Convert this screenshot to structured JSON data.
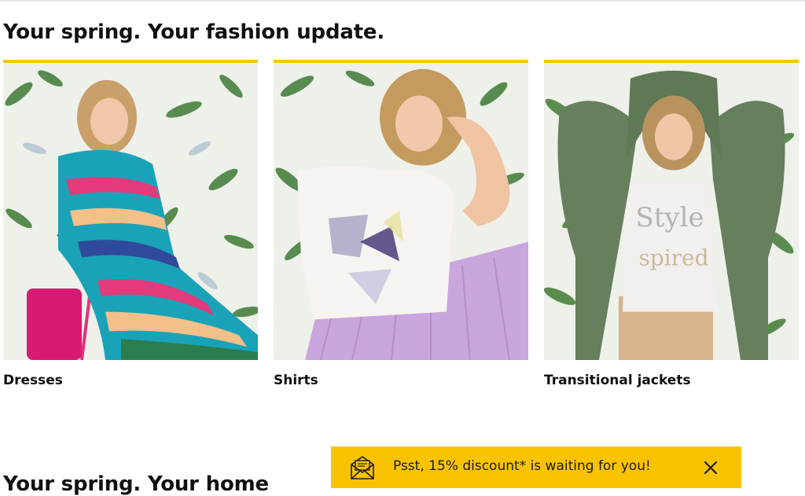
{
  "section": {
    "title": "Your spring. Your fashion update.",
    "next_title": "Your spring. Your home"
  },
  "categories": [
    {
      "label": "Dresses",
      "image_alt": "Model in multicolored striped dress sitting on pink chair"
    },
    {
      "label": "Shirts",
      "image_alt": "Model in white top with geometric print and lilac pleated skirt"
    },
    {
      "label": "Transitional jackets",
      "image_alt": "Model in green hooded parka and white printed tee"
    }
  ],
  "promo": {
    "text": "Psst, 15% discount* is waiting for you!",
    "icon": "envelope-icon",
    "close_icon": "close-icon"
  },
  "colors": {
    "accent": "#f9c302",
    "text": "#111111"
  }
}
